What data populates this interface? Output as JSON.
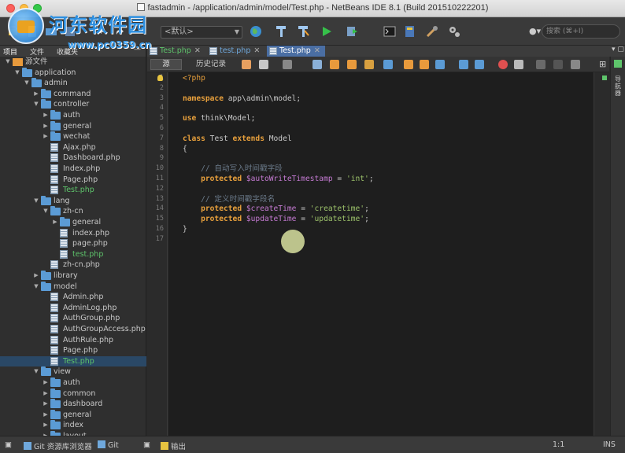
{
  "window": {
    "title": "fastadmin - /application/admin/model/Test.php - NetBeans IDE 8.1 (Build 201510222201)"
  },
  "watermark": {
    "brand": "河东软件园",
    "url": "www.pc0359.cn"
  },
  "toolbar": {
    "config_value": "<默认>",
    "search_placeholder": "搜索 (⌘+I)"
  },
  "left_panel": {
    "tabs": [
      "项目",
      "文件",
      "收藏夹"
    ],
    "minimize": "—",
    "tree": [
      {
        "label": "源文件",
        "depth": 0,
        "type": "root",
        "expanded": true
      },
      {
        "label": "application",
        "depth": 1,
        "type": "folder",
        "expanded": true
      },
      {
        "label": "admin",
        "depth": 2,
        "type": "folder",
        "expanded": true
      },
      {
        "label": "command",
        "depth": 3,
        "type": "pkg",
        "expanded": false
      },
      {
        "label": "controller",
        "depth": 3,
        "type": "folder",
        "expanded": true
      },
      {
        "label": "auth",
        "depth": 4,
        "type": "pkg",
        "expanded": false
      },
      {
        "label": "general",
        "depth": 4,
        "type": "pkg",
        "expanded": false
      },
      {
        "label": "wechat",
        "depth": 4,
        "type": "pkg",
        "expanded": false
      },
      {
        "label": "Ajax.php",
        "depth": 4,
        "type": "file"
      },
      {
        "label": "Dashboard.php",
        "depth": 4,
        "type": "file"
      },
      {
        "label": "Index.php",
        "depth": 4,
        "type": "file"
      },
      {
        "label": "Page.php",
        "depth": 4,
        "type": "file"
      },
      {
        "label": "Test.php",
        "depth": 4,
        "type": "file",
        "color": "green"
      },
      {
        "label": "lang",
        "depth": 3,
        "type": "folder",
        "expanded": true
      },
      {
        "label": "zh-cn",
        "depth": 4,
        "type": "folder",
        "expanded": true
      },
      {
        "label": "general",
        "depth": 5,
        "type": "pkg",
        "expanded": false
      },
      {
        "label": "index.php",
        "depth": 5,
        "type": "file"
      },
      {
        "label": "page.php",
        "depth": 5,
        "type": "file"
      },
      {
        "label": "test.php",
        "depth": 5,
        "type": "file",
        "color": "green"
      },
      {
        "label": "zh-cn.php",
        "depth": 4,
        "type": "file"
      },
      {
        "label": "library",
        "depth": 3,
        "type": "pkg",
        "expanded": false
      },
      {
        "label": "model",
        "depth": 3,
        "type": "folder",
        "expanded": true
      },
      {
        "label": "Admin.php",
        "depth": 4,
        "type": "file"
      },
      {
        "label": "AdminLog.php",
        "depth": 4,
        "type": "file"
      },
      {
        "label": "AuthGroup.php",
        "depth": 4,
        "type": "file"
      },
      {
        "label": "AuthGroupAccess.php",
        "depth": 4,
        "type": "file"
      },
      {
        "label": "AuthRule.php",
        "depth": 4,
        "type": "file"
      },
      {
        "label": "Page.php",
        "depth": 4,
        "type": "file"
      },
      {
        "label": "Test.php",
        "depth": 4,
        "type": "file",
        "color": "green",
        "selected": true
      },
      {
        "label": "view",
        "depth": 3,
        "type": "folder",
        "expanded": true
      },
      {
        "label": "auth",
        "depth": 4,
        "type": "pkg",
        "expanded": false
      },
      {
        "label": "common",
        "depth": 4,
        "type": "pkg",
        "expanded": false
      },
      {
        "label": "dashboard",
        "depth": 4,
        "type": "pkg",
        "expanded": false
      },
      {
        "label": "general",
        "depth": 4,
        "type": "pkg",
        "expanded": false
      },
      {
        "label": "index",
        "depth": 4,
        "type": "pkg",
        "expanded": false
      },
      {
        "label": "layout",
        "depth": 4,
        "type": "pkg",
        "expanded": false
      }
    ]
  },
  "editor_tabs": [
    {
      "label": "Test.php",
      "color": "green",
      "active": false
    },
    {
      "label": "test.php",
      "color": "blue",
      "active": false
    },
    {
      "label": "Test.php",
      "color": "white",
      "active": true
    }
  ],
  "editor_toolbar": {
    "source_label": "源",
    "history_label": "历史记录"
  },
  "code": {
    "line_count": 17,
    "lines": [
      [
        {
          "t": "<?php",
          "c": "php"
        }
      ],
      [],
      [
        {
          "t": "namespace",
          "c": "kw"
        },
        {
          "t": " app\\admin\\model;",
          "c": ""
        }
      ],
      [],
      [
        {
          "t": "use",
          "c": "kw"
        },
        {
          "t": " think\\Model;",
          "c": ""
        }
      ],
      [],
      [
        {
          "t": "class",
          "c": "kw"
        },
        {
          "t": " Test ",
          "c": ""
        },
        {
          "t": "extends",
          "c": "kw"
        },
        {
          "t": " Model",
          "c": ""
        }
      ],
      [
        {
          "t": "{",
          "c": ""
        }
      ],
      [],
      [
        {
          "t": "    // 自动写入时间戳字段",
          "c": "cm"
        }
      ],
      [
        {
          "t": "    ",
          "c": ""
        },
        {
          "t": "protected",
          "c": "kw"
        },
        {
          "t": " ",
          "c": ""
        },
        {
          "t": "$autoWriteTimestamp",
          "c": "var"
        },
        {
          "t": " = ",
          "c": ""
        },
        {
          "t": "'int'",
          "c": "str"
        },
        {
          "t": ";",
          "c": ""
        }
      ],
      [],
      [
        {
          "t": "    // 定义时间戳字段名",
          "c": "cm"
        }
      ],
      [
        {
          "t": "    ",
          "c": ""
        },
        {
          "t": "protected",
          "c": "kw"
        },
        {
          "t": " ",
          "c": ""
        },
        {
          "t": "$createTime",
          "c": "var"
        },
        {
          "t": " = ",
          "c": ""
        },
        {
          "t": "'createtime'",
          "c": "str"
        },
        {
          "t": ";",
          "c": ""
        }
      ],
      [
        {
          "t": "    ",
          "c": ""
        },
        {
          "t": "protected",
          "c": "kw"
        },
        {
          "t": " ",
          "c": ""
        },
        {
          "t": "$updateTime",
          "c": "var"
        },
        {
          "t": " = ",
          "c": ""
        },
        {
          "t": "'updatetime'",
          "c": "str"
        },
        {
          "t": ";",
          "c": ""
        }
      ],
      [
        {
          "t": "}",
          "c": ""
        }
      ],
      []
    ]
  },
  "right_strip": {
    "navigator_label": "导航器"
  },
  "statusbar": {
    "git_repo_browser": "Git 资源库浏览器",
    "git": "Git",
    "output": "输出",
    "position": "1:1",
    "mode": "INS"
  },
  "colors": {
    "keyword": "#e8a03c",
    "string": "#9cc26a",
    "variable": "#c47ad2",
    "comment": "#6b7a8a",
    "modified_file": "#5ec46b",
    "active_tab": "#4a6ea3"
  }
}
